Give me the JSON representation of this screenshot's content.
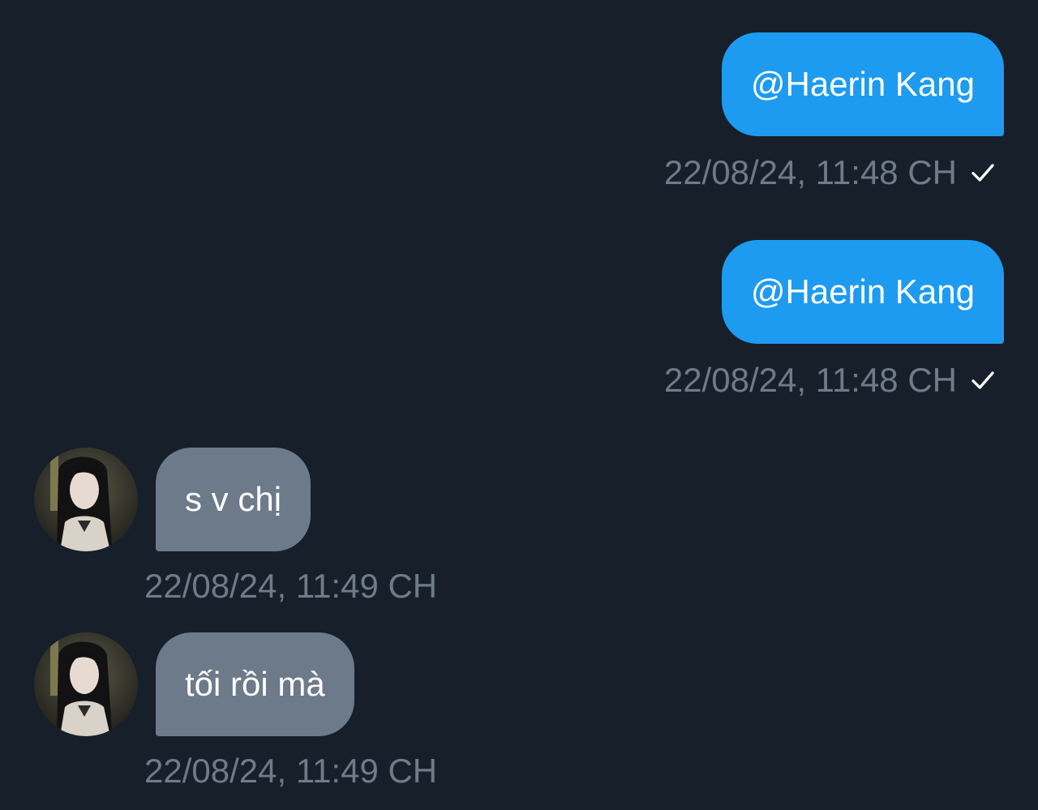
{
  "conversation": {
    "messages": [
      {
        "direction": "sent",
        "text": "@Haerin Kang",
        "timestamp": "22/08/24, 11:48 CH",
        "status_icon": "check-icon"
      },
      {
        "direction": "sent",
        "text": "@Haerin Kang",
        "timestamp": "22/08/24, 11:48 CH",
        "status_icon": "check-icon"
      },
      {
        "direction": "received",
        "text": "s v chị",
        "timestamp": "22/08/24, 11:49 CH",
        "avatar_icon": "avatar"
      },
      {
        "direction": "received",
        "text": "tối rồi mà",
        "timestamp": "22/08/24, 11:49 CH",
        "avatar_icon": "avatar"
      }
    ]
  },
  "colors": {
    "background": "#171f2a",
    "sent_bubble": "#1d9bf0",
    "received_bubble": "#6d7a89",
    "timestamp": "#6f7b88",
    "check": "#ffffff"
  }
}
